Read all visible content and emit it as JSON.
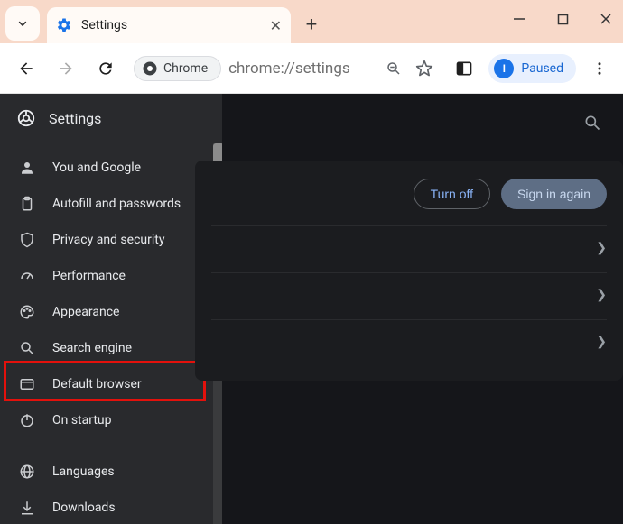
{
  "window": {
    "tab_title": "Settings",
    "new_tab_tooltip": "+",
    "win_min": "—",
    "win_max": "▢",
    "win_close": "✕"
  },
  "toolbar": {
    "chrome_chip": "Chrome",
    "address": "chrome://settings",
    "paused_label": "Paused",
    "avatar_initial": "I"
  },
  "sidebar": {
    "header": "Settings",
    "items": [
      {
        "label": "You and Google"
      },
      {
        "label": "Autofill and passwords"
      },
      {
        "label": "Privacy and security"
      },
      {
        "label": "Performance"
      },
      {
        "label": "Appearance"
      },
      {
        "label": "Search engine"
      },
      {
        "label": "Default browser"
      },
      {
        "label": "On startup"
      }
    ],
    "items2": [
      {
        "label": "Languages"
      },
      {
        "label": "Downloads"
      }
    ]
  },
  "main": {
    "turn_off": "Turn off",
    "sign_in_again": "Sign in again"
  }
}
